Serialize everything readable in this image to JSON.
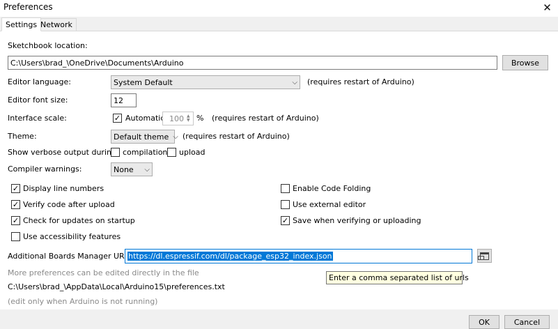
{
  "window": {
    "title": "Preferences"
  },
  "tabs": [
    {
      "label": "Settings"
    },
    {
      "label": "Network"
    }
  ],
  "sketchbook": {
    "label": "Sketchbook location:",
    "value": "C:\\Users\\brad_\\OneDrive\\Documents\\Arduino",
    "browse_label": "Browse"
  },
  "language": {
    "label": "Editor language:",
    "value": "System Default",
    "note": "(requires restart of Arduino)"
  },
  "font_size": {
    "label": "Editor font size:",
    "value": "12"
  },
  "scale": {
    "label": "Interface scale:",
    "auto_label": "Automatic",
    "auto_checked": true,
    "value": "100",
    "unit": "%",
    "note": "(requires restart of Arduino)"
  },
  "theme": {
    "label": "Theme:",
    "value": "Default theme",
    "note": "(requires restart of Arduino)"
  },
  "verbose": {
    "label": "Show verbose output during:",
    "compilation_label": "compilation",
    "upload_label": "upload"
  },
  "warnings": {
    "label": "Compiler warnings:",
    "value": "None"
  },
  "options": {
    "display_line_numbers": {
      "label": "Display line numbers",
      "checked": true
    },
    "verify_after_upload": {
      "label": "Verify code after upload",
      "checked": true
    },
    "check_updates": {
      "label": "Check for updates on startup",
      "checked": true
    },
    "accessibility": {
      "label": "Use accessibility features",
      "checked": false
    },
    "code_folding": {
      "label": "Enable Code Folding",
      "checked": false
    },
    "external_editor": {
      "label": "Use external editor",
      "checked": false
    },
    "save_on_verify": {
      "label": "Save when verifying or uploading",
      "checked": true
    }
  },
  "boards": {
    "label": "Additional Boards Manager URLs:",
    "value": "https://dl.espressif.com/dl/package_esp32_index.json",
    "tooltip": "Enter a comma separated list of urls"
  },
  "footer": {
    "more_prefs": "More preferences can be edited directly in the file",
    "path": "C:\\Users\\brad_\\AppData\\Local\\Arduino15\\preferences.txt",
    "note": "(edit only when Arduino is not running)"
  },
  "buttons": {
    "ok": "OK",
    "cancel": "Cancel"
  },
  "icons": {
    "close": "close-icon",
    "dropdown": "chevron-down-icon",
    "check": "checkmark-icon",
    "window": "window-icon"
  }
}
